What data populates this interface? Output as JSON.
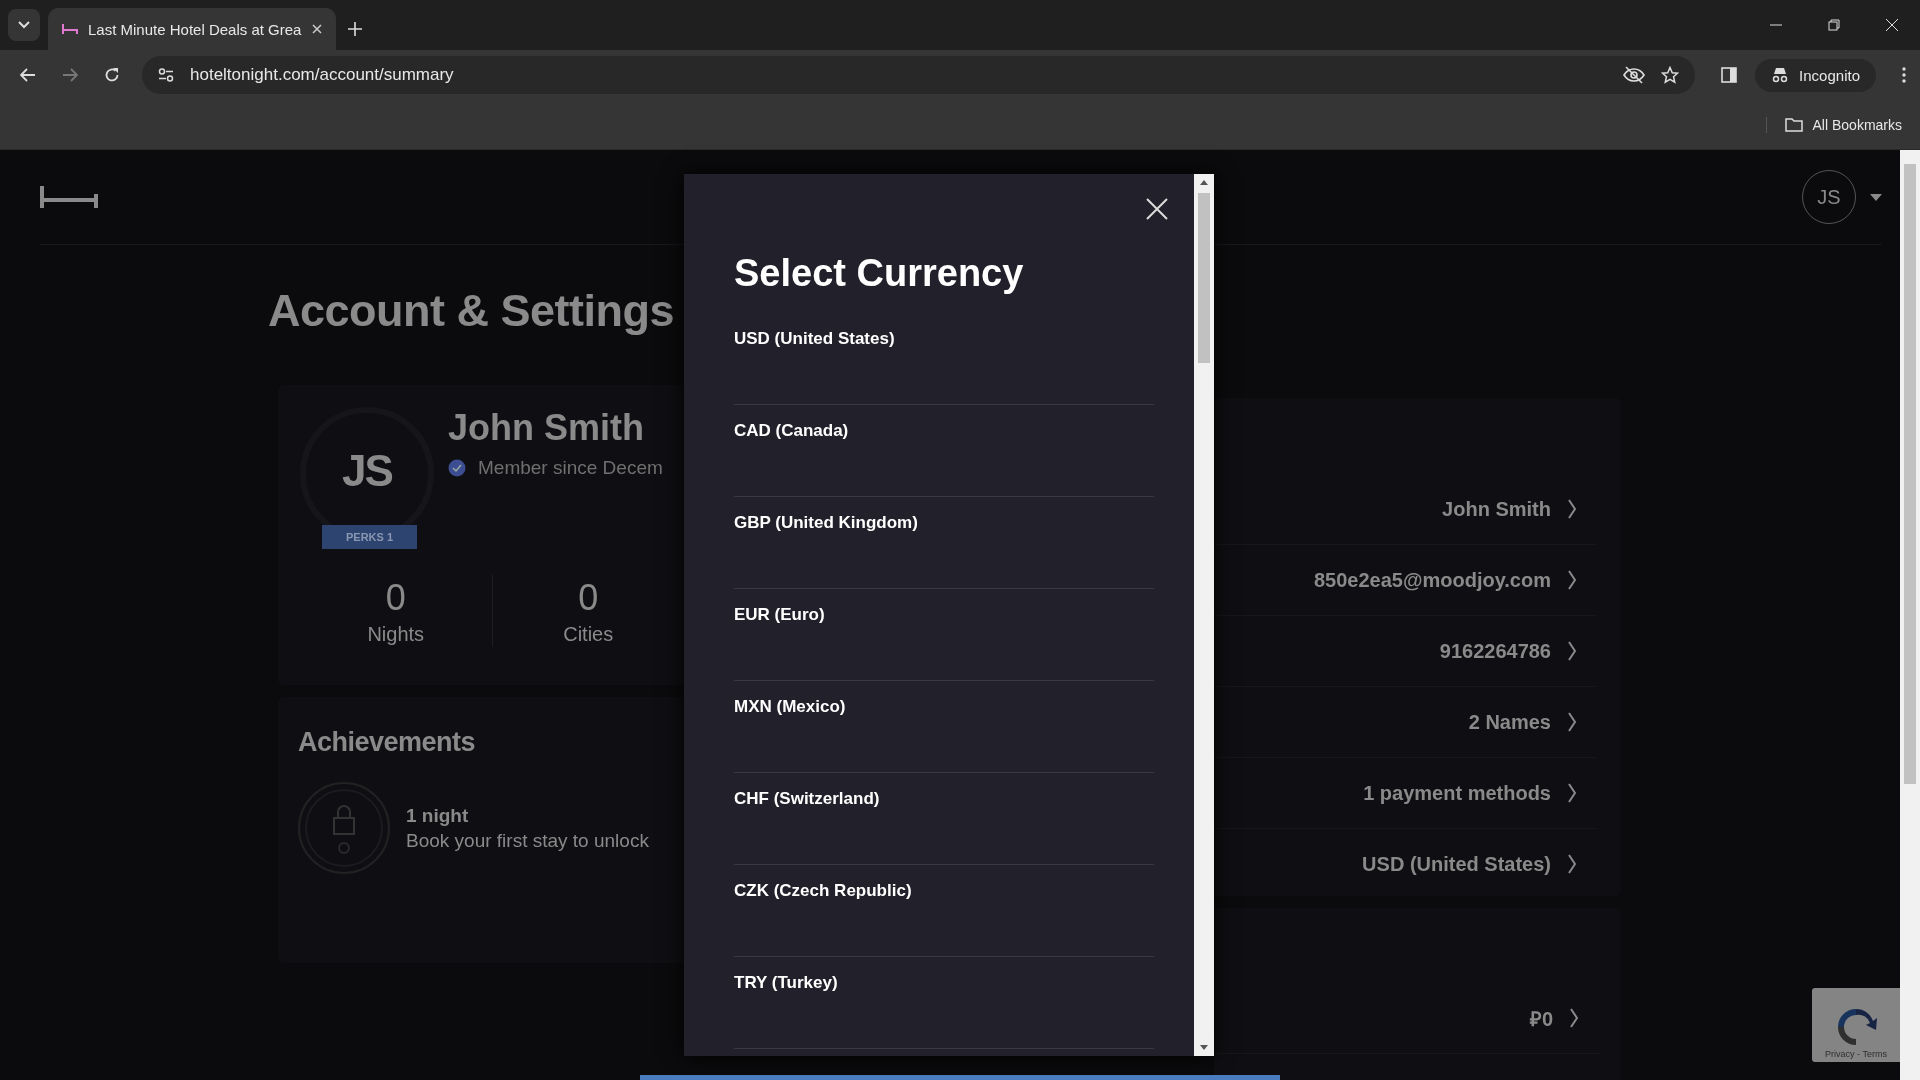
{
  "browser": {
    "tab_title": "Last Minute Hotel Deals at Grea",
    "url": "hoteltonight.com/account/summary",
    "profile_label": "Incognito",
    "bookmarks_label": "All Bookmarks"
  },
  "header": {
    "avatar_initials": "JS"
  },
  "page_title": "Account & Settings",
  "profile": {
    "initials": "JS",
    "badge": "PERKS 1",
    "name": "John Smith",
    "member_since": "Member since Decem",
    "stats": [
      {
        "value": "0",
        "label": "Nights"
      },
      {
        "value": "0",
        "label": "Cities"
      }
    ]
  },
  "achievements": {
    "title": "Achievements",
    "items": [
      {
        "title": "1 night",
        "text": "Book your first stay to unlock"
      }
    ]
  },
  "account_rows": [
    {
      "value": "John Smith"
    },
    {
      "value": "850e2ea5@moodjoy.com"
    },
    {
      "value": "9162264786"
    },
    {
      "value": "2 Names"
    },
    {
      "value": "1 payment methods"
    },
    {
      "value": "USD (United States)"
    }
  ],
  "credit_rows": [
    {
      "value": "₽0"
    }
  ],
  "modal": {
    "title": "Select Currency",
    "options": [
      {
        "label": "USD (United States)"
      },
      {
        "label": "CAD (Canada)"
      },
      {
        "label": "GBP (United Kingdom)"
      },
      {
        "label": "EUR (Euro)"
      },
      {
        "label": "MXN (Mexico)"
      },
      {
        "label": "CHF (Switzerland)"
      },
      {
        "label": "CZK (Czech Republic)"
      },
      {
        "label": "TRY (Turkey)"
      }
    ]
  },
  "recaptcha": {
    "links": "Privacy - Terms"
  }
}
